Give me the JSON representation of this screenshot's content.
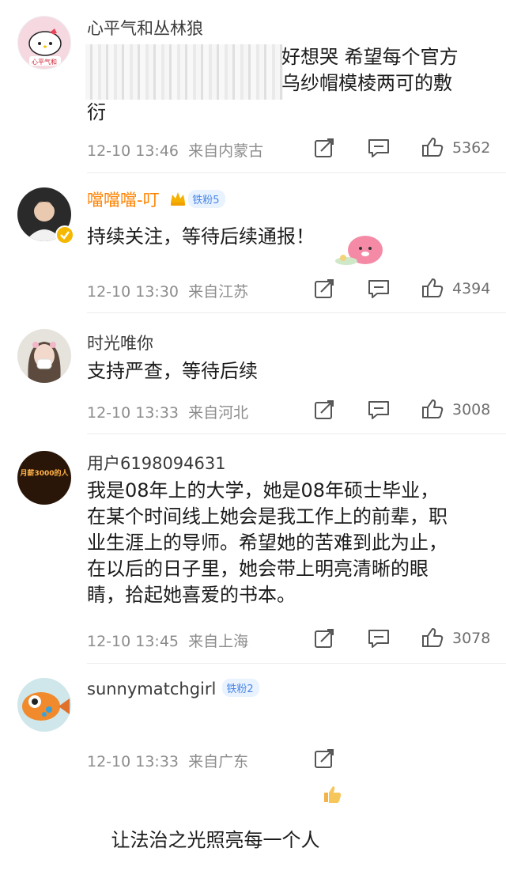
{
  "comments": [
    {
      "user": "心平气和丛林狼",
      "avatar_label": "心平气和",
      "text_line1": "好想哭 希望每个官方",
      "text_line2": "乌纱帽模棱两可的敷",
      "text_line3": "衍",
      "time": "12-10 13:46",
      "location": "来自内蒙古",
      "likes": "5362"
    },
    {
      "user": "噹噹噹-叮",
      "badge": "铁粉5",
      "text": "持续关注，等待后续通报！",
      "time": "12-10 13:30",
      "location": "来自江苏",
      "likes": "4394"
    },
    {
      "user": "时光唯你",
      "text": "支持严查，等待后续",
      "time": "12-10 13:33",
      "location": "来自河北",
      "likes": "3008"
    },
    {
      "user": "用户6198094631",
      "avatar_text": "月薪3000的人",
      "text": "我是08年上的大学，她是08年硕士毕业，\n在某个时间线上她会是我工作上的前辈，职\n业生涯上的导师。希望她的苦难到此为止，\n在以后的日子里，她会带上明亮清晰的眼\n睛，拾起她喜爱的书本。",
      "time": "12-10 13:45",
      "location": "来自上海",
      "likes": "3078"
    },
    {
      "user": "sunnymatchgirl",
      "badge": "铁粉2",
      "text": "让法治之光照亮每一个人",
      "time": "12-10 13:33",
      "location": "来自广东"
    }
  ],
  "colors": {
    "accent": "#ff8200",
    "meta": "#8c8c8c",
    "badge": "#4a88e6"
  }
}
